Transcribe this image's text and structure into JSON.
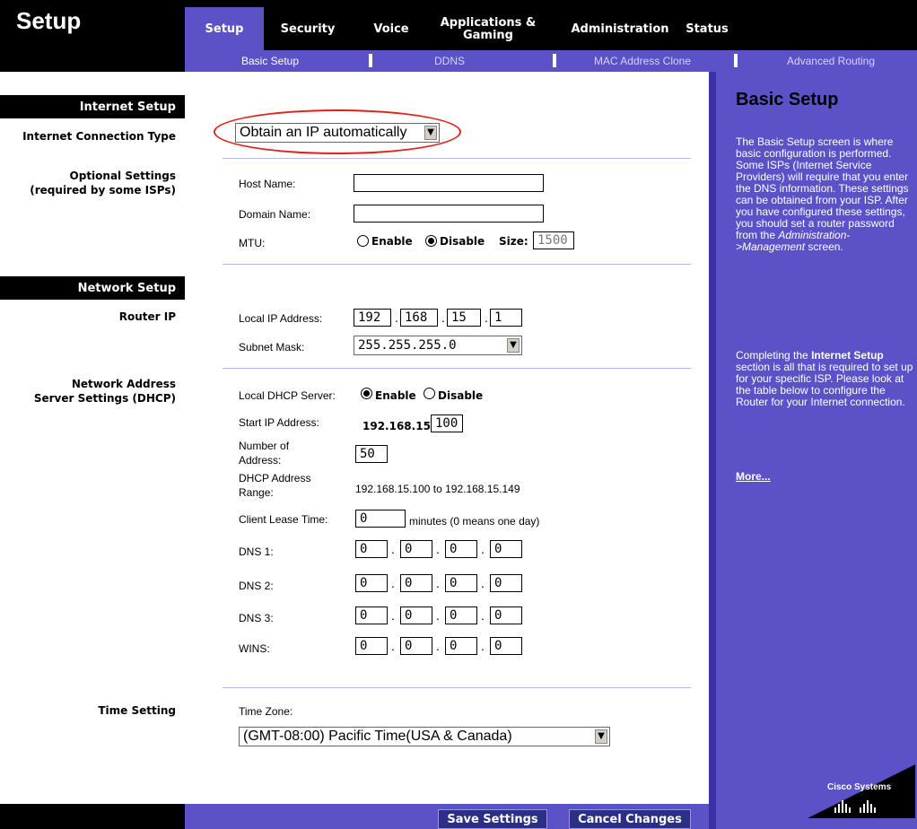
{
  "header": {
    "title": "Setup",
    "tabs": [
      {
        "label": "Setup",
        "active": true
      },
      {
        "label": "Security",
        "active": false
      },
      {
        "label": "Voice",
        "active": false
      },
      {
        "label": "Applications & Gaming",
        "active": false
      },
      {
        "label": "Administration",
        "active": false
      },
      {
        "label": "Status",
        "active": false
      }
    ],
    "subtabs": [
      {
        "label": "Basic Setup",
        "active": true
      },
      {
        "label": "DDNS",
        "active": false
      },
      {
        "label": "MAC Address Clone",
        "active": false
      },
      {
        "label": "Advanced Routing",
        "active": false
      }
    ]
  },
  "left": {
    "internet_setup": "Internet Setup",
    "connection_type": "Internet Connection Type",
    "optional_settings": "Optional Settings",
    "optional_sub": "(required by some ISPs)",
    "network_setup": "Network Setup",
    "router_ip": "Router IP",
    "dhcp_line1": "Network Address",
    "dhcp_line2": "Server Settings (DHCP)",
    "time_setting": "Time Setting"
  },
  "internet": {
    "connection_type_value": "Obtain an IP automatically",
    "host_name_label": "Host Name:",
    "host_name_value": "",
    "domain_name_label": "Domain Name:",
    "domain_name_value": "",
    "mtu_label": "MTU:",
    "mtu_enable": "Enable",
    "mtu_disable": "Disable",
    "mtu_selected": "Disable",
    "mtu_size_label": "Size:",
    "mtu_size_value": "1500"
  },
  "router": {
    "local_ip_label": "Local IP Address:",
    "local_ip": [
      "192",
      "168",
      "15",
      "1"
    ],
    "subnet_label": "Subnet Mask:",
    "subnet_value": "255.255.255.0"
  },
  "dhcp": {
    "server_label": "Local DHCP Server:",
    "enable": "Enable",
    "disable": "Disable",
    "selected": "Enable",
    "start_label": "Start IP Address:",
    "start_prefix": "192.168.15.",
    "start_value": "100",
    "number_label_1": "Number of",
    "number_label_2": "Address:",
    "number_value": "50",
    "range_label_1": "DHCP Address",
    "range_label_2": "Range:",
    "range_value": "192.168.15.100 to 192.168.15.149",
    "lease_label": "Client Lease Time:",
    "lease_value": "0",
    "lease_suffix": "minutes (0 means one day)",
    "dns1_label": "DNS 1:",
    "dns1": [
      "0",
      "0",
      "0",
      "0"
    ],
    "dns2_label": "DNS 2:",
    "dns2": [
      "0",
      "0",
      "0",
      "0"
    ],
    "dns3_label": "DNS 3:",
    "dns3": [
      "0",
      "0",
      "0",
      "0"
    ],
    "wins_label": "WINS:",
    "wins": [
      "0",
      "0",
      "0",
      "0"
    ]
  },
  "time": {
    "zone_label": "Time Zone:",
    "zone_value": "(GMT-08:00) Pacific Time(USA & Canada)"
  },
  "help": {
    "title": "Basic Setup",
    "para1": "The Basic Setup screen is where basic configuration is performed. Some ISPs (Internet Service Providers) will require that you enter the DNS information. These settings can be obtained from your ISP. After you have configured these settings, you should set a router password from the",
    "para1_link": "Administration->Management",
    "para1_end": "screen.",
    "para2_start": "Completing the",
    "para2_bold": "Internet Setup",
    "para2_rest": "section is all that is required to set up for your specific ISP. Please look at the table below to configure the Router for your Internet connection.",
    "more": "More..."
  },
  "footer": {
    "save_label": "Save Settings",
    "cancel_label": "Cancel Changes"
  },
  "logo": {
    "text": "Cisco Systems"
  },
  "colors": {
    "accent": "#5b52c7",
    "header": "#000000",
    "button": "#2c2f86",
    "highlight_oval": "#e0201c"
  }
}
